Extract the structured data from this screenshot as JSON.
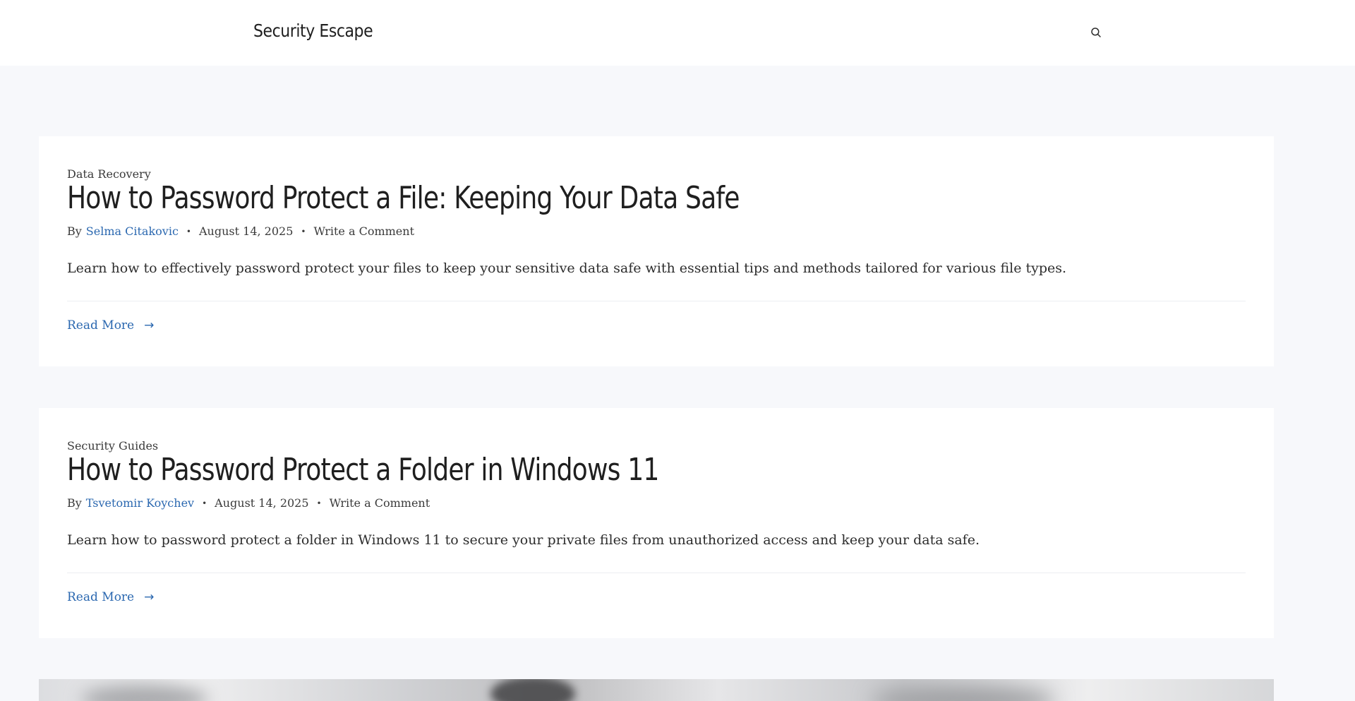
{
  "header": {
    "site_title": "Security Escape",
    "search_icon": "search-icon"
  },
  "posts": [
    {
      "category": "Data Recovery",
      "title": "How to Password Protect a File: Keeping Your Data Safe",
      "by": "By",
      "author": "Selma Citakovic",
      "date": "August 14, 2025",
      "comment": "Write a Comment",
      "excerpt": "Learn how to effectively password protect your files to keep your sensitive data safe with essential tips and methods tailored for various file types.",
      "read_more": "Read More",
      "arrow": "→"
    },
    {
      "category": "Security Guides",
      "title": "How to Password Protect a Folder in Windows 11",
      "by": "By",
      "author": "Tsvetomir Koychev",
      "date": "August 14, 2025",
      "comment": "Write a Comment",
      "excerpt": "Learn how to password protect a folder in Windows 11 to secure your private files from unauthorized access and keep your data safe.",
      "read_more": "Read More",
      "arrow": "→"
    }
  ],
  "meta_separator": "•",
  "colors": {
    "accent": "#2b68b0",
    "page_background": "#f7f8fb",
    "card_background": "#ffffff",
    "text": "#2d2d2d"
  }
}
